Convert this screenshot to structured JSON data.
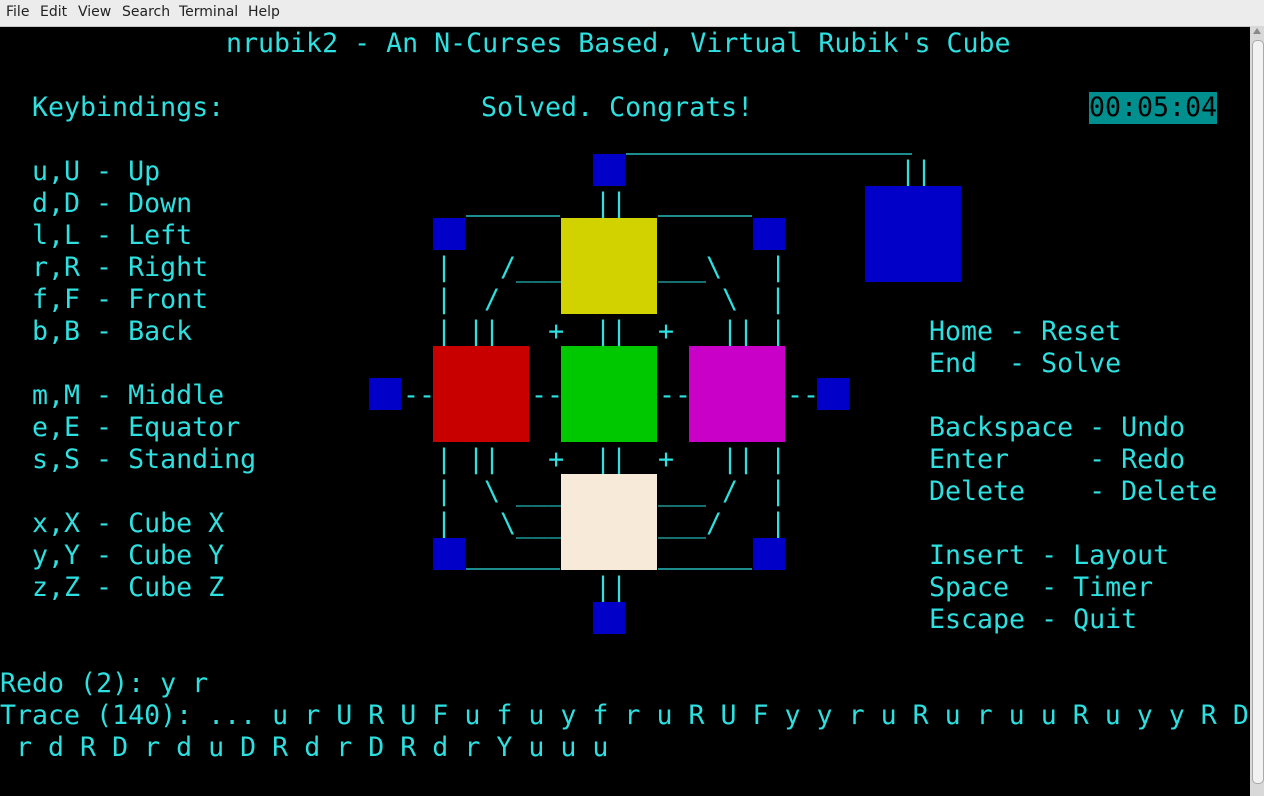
{
  "menu": [
    "File",
    "Edit",
    "View",
    "Search",
    "Terminal",
    "Help"
  ],
  "title": "nrubik2 - An N-Curses Based, Virtual Rubik's Cube",
  "keybindings_heading": "Keybindings:",
  "status": "Solved. Congrats!",
  "timer": "00:05:04",
  "keys_left": [
    "u,U - Up",
    "d,D - Down",
    "l,L - Left",
    "r,R - Right",
    "f,F - Front",
    "b,B - Back",
    "",
    "m,M - Middle",
    "e,E - Equator",
    "s,S - Standing",
    "",
    "x,X - Cube X",
    "y,Y - Cube Y",
    "z,Z - Cube Z"
  ],
  "keys_right": [
    "Home - Reset",
    "End  - Solve",
    "",
    "Backspace - Undo",
    "Enter     - Redo",
    "Delete    - Delete",
    "",
    "Insert - Layout",
    "Space  - Timer",
    "Escape - Quit"
  ],
  "redo": "Redo (2): y r",
  "trace_line1": "Trace (140): ... u r U R U F u f u y f r u R U F y y r u R u r u u R u y y R D",
  "trace_line2": " r d R D r d u D R d r D R d r Y u u u",
  "faces": {
    "up": "#d2d200",
    "left": "#c80000",
    "front": "#00c800",
    "right": "#c800c8",
    "down": "#f8ead8",
    "back": "#0000c8",
    "edge": "#0000c8"
  },
  "ascii_art": [
    "||",
    "||",
    "|   /___",
    "___\\   |",
    "|  /",
    "\\  |",
    "| ||   +",
    "+   || |",
    "--",
    "| ||   +",
    "+   || |",
    "|  \\ ___",
    "___ /  |",
    "|   \\___",
    "___/   |",
    "||"
  ]
}
